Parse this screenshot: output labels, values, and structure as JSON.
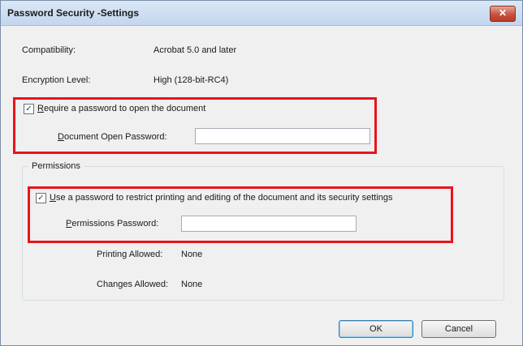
{
  "window": {
    "title": "Password Security -Settings",
    "close_label": "✕"
  },
  "info": {
    "compatibility_label": "Compatibility:",
    "compatibility_value": "Acrobat 5.0 and later",
    "encryption_label": "Encryption Level:",
    "encryption_value": "High (128-bit-RC4)"
  },
  "open_password": {
    "checkbox_checked": true,
    "checkbox_label_accesskey": "R",
    "checkbox_label_rest": "equire a password to open the document",
    "field_label_accesskey": "D",
    "field_label_rest": "ocument Open Password:",
    "field_value": ""
  },
  "permissions": {
    "group_label": "Permissions",
    "checkbox_checked": true,
    "checkbox_label_accesskey": "U",
    "checkbox_label_rest": "se a password to restrict printing and editing of the document and its security settings",
    "field_label_accesskey": "P",
    "field_label_rest": "ermissions Password:",
    "field_value": "",
    "printing_label": "Printing Allowed:",
    "printing_value": "None",
    "changes_label": "Changes Allowed:",
    "changes_value": "None"
  },
  "buttons": {
    "ok_label": "OK",
    "cancel_label": "Cancel"
  },
  "colors": {
    "highlight": "#e8141b"
  }
}
